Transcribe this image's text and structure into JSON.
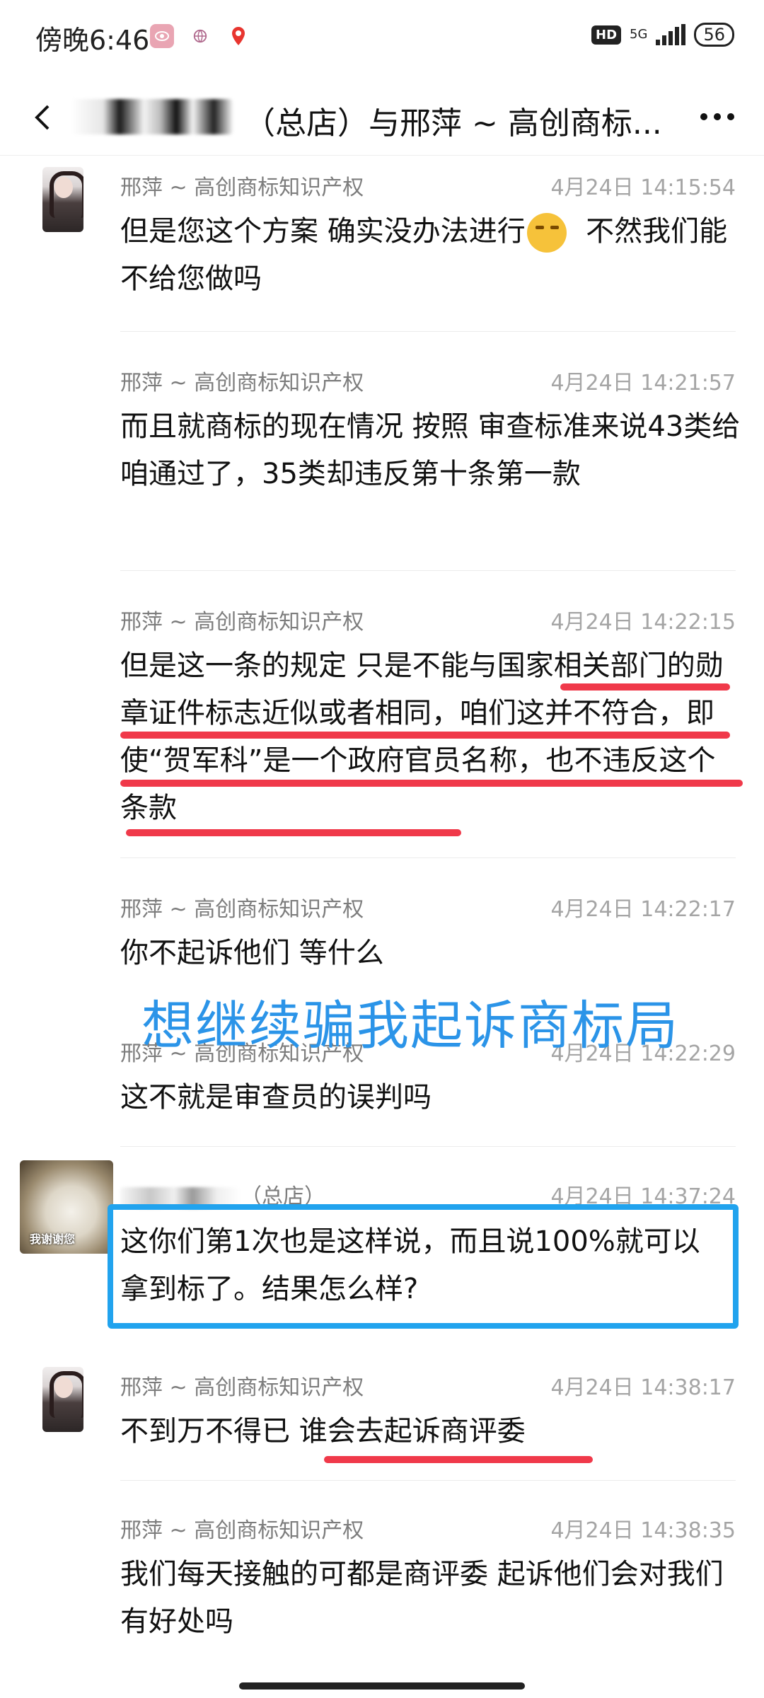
{
  "status_bar": {
    "time": "傍晚6:46",
    "hd": "HD",
    "network": "5G",
    "battery": "56"
  },
  "header": {
    "title": "（总店）与邢萍 ~ 高创商标..."
  },
  "messages": [
    {
      "sender": "邢萍 ~ 高创商标知识产权",
      "time": "4月24日 14:15:54",
      "text_before_emoji": "但是您这个方案 确实没办法进行",
      "text_after_emoji": "  不然我们能不给您做吗"
    },
    {
      "sender": "邢萍 ~ 高创商标知识产权",
      "time": "4月24日 14:21:57",
      "text": "而且就商标的现在情况  按照 审查标准来说43类给咱通过了，35类却违反第十条第一款"
    },
    {
      "sender": "邢萍 ~ 高创商标知识产权",
      "time": "4月24日 14:22:15",
      "text": "但是这一条的规定  只是不能与国家相关部门的勋章证件标志近似或者相同，咱们这并不符合，即使“贺军科”是一个政府官员名称，也不违反这个条款"
    },
    {
      "sender": "邢萍 ~ 高创商标知识产权",
      "time": "4月24日 14:22:17",
      "text": "你不起诉他们  等什么"
    },
    {
      "sender": "邢萍 ~ 高创商标知识产权",
      "time": "4月24日 14:22:29",
      "text": "这不就是审查员的误判吗"
    },
    {
      "sender": "（总店）",
      "time": "4月24日 14:37:24",
      "text": "这你们第1次也是这样说，而且说100%就可以拿到标了。结果怎么样?",
      "avatar_caption": "我谢谢您"
    },
    {
      "sender": "邢萍 ~ 高创商标知识产权",
      "time": "4月24日 14:38:17",
      "text": "不到万不得已 谁会去起诉商评委"
    },
    {
      "sender": "邢萍 ~ 高创商标知识产权",
      "time": "4月24日 14:38:35",
      "text": "我们每天接触的可都是商评委 起诉他们会对我们有好处吗"
    }
  ],
  "annotation": {
    "overlay_text": "想继续骗我起诉商标局",
    "overlay_color": "#2b94e8",
    "underline_color": "#f0394a",
    "box_color": "#21a3ee"
  }
}
